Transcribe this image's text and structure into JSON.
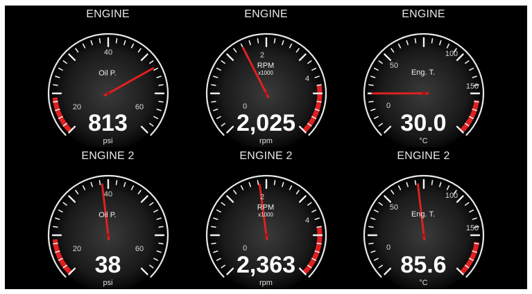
{
  "accent_red": "#e02020",
  "gauges": [
    {
      "title": "ENGINE",
      "name": "Oil P.",
      "sub": "",
      "value": "813",
      "unit": "psi",
      "ticks": [
        "40",
        "20",
        "60"
      ],
      "min": 0,
      "max": 80,
      "needle": 58,
      "redLow": [
        0,
        12
      ],
      "kind": "oil"
    },
    {
      "title": "ENGINE",
      "name": "RPM",
      "sub": "x1000",
      "value": "2,025",
      "unit": "rpm",
      "ticks": [
        "0",
        "2",
        "4"
      ],
      "min": 0,
      "max": 5,
      "needle": 2.0,
      "redHigh": [
        4.0,
        5.0
      ],
      "kind": "rpm"
    },
    {
      "title": "ENGINE",
      "name": "Eng. T.",
      "sub": "",
      "value": "30.0",
      "unit": "°C",
      "ticks": [
        "0",
        "50",
        "100",
        "150"
      ],
      "min": 0,
      "max": 180,
      "needle": 30,
      "redHigh": [
        155,
        180
      ],
      "kind": "temp"
    },
    {
      "title": "ENGINE 2",
      "name": "Oil P.",
      "sub": "",
      "value": "38",
      "unit": "psi",
      "ticks": [
        "40",
        "20",
        "60"
      ],
      "min": 0,
      "max": 80,
      "needle": 38,
      "redLow": [
        0,
        12
      ],
      "kind": "oil"
    },
    {
      "title": "ENGINE 2",
      "name": "RPM",
      "sub": "x1000",
      "value": "2,363",
      "unit": "rpm",
      "ticks": [
        "0",
        "2",
        "4"
      ],
      "min": 0,
      "max": 5,
      "needle": 2.36,
      "redHigh": [
        4.0,
        5.0
      ],
      "kind": "rpm"
    },
    {
      "title": "ENGINE 2",
      "name": "Eng. T.",
      "sub": "",
      "value": "85.6",
      "unit": "°C",
      "ticks": [
        "0",
        "50",
        "100",
        "150"
      ],
      "min": 0,
      "max": 180,
      "needle": 85.6,
      "redHigh": [
        155,
        180
      ],
      "kind": "temp"
    }
  ]
}
